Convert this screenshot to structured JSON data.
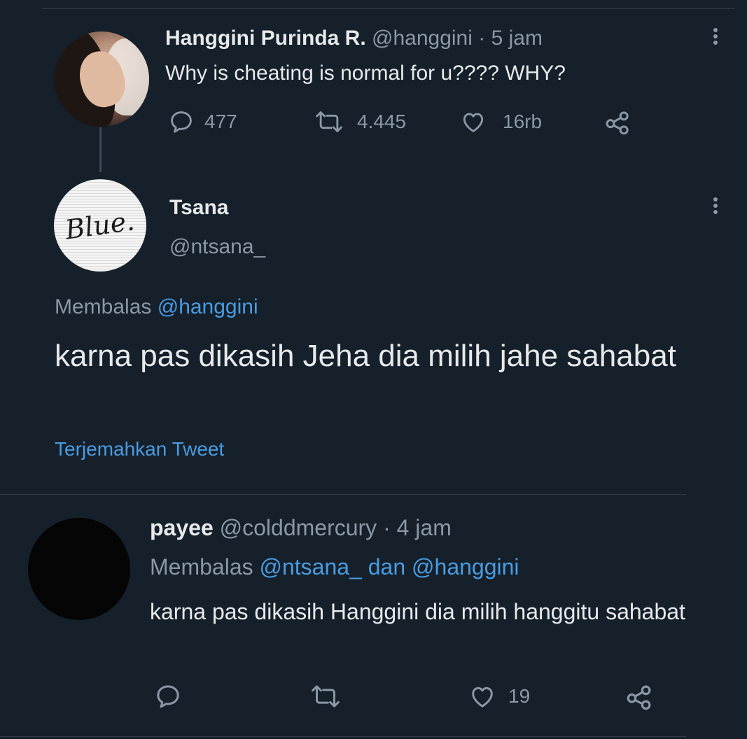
{
  "tweet1": {
    "name": "Hanggini Purinda R.",
    "handle": "@hanggini",
    "separator": "·",
    "time": "5 jam",
    "text": "Why is cheating is normal for u???? WHY?",
    "replies": "477",
    "retweets": "4.445",
    "likes": "16rb"
  },
  "tweet2": {
    "avatar_text": "Blue.",
    "name": "Tsana",
    "handle": "@ntsana_",
    "reply_prefix": "Membalas",
    "reply_to": "@hanggini",
    "text": "karna pas dikasih Jeha dia milih jahe sahabat",
    "translate": "Terjemahkan Tweet"
  },
  "tweet3": {
    "name": "payee",
    "handle": "@colddmercury",
    "separator": "·",
    "time": "4 jam",
    "reply_prefix": "Membalas",
    "reply_to_1": "@ntsana_",
    "reply_and": "dan",
    "reply_to_2": "@hanggini",
    "text": "karna pas dikasih Hanggini dia milih hanggitu sahabat",
    "likes": "19"
  },
  "colors": {
    "background": "#15202b",
    "link": "#1d9bf0",
    "muted": "#8b98a5"
  },
  "icons": [
    "reply-icon",
    "retweet-icon",
    "like-icon",
    "share-icon",
    "more-icon"
  ]
}
